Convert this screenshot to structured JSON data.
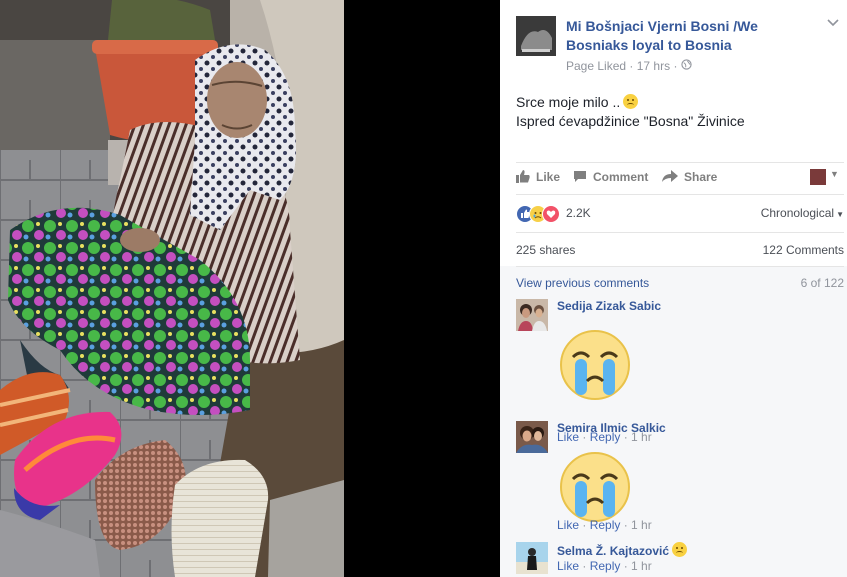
{
  "page": {
    "name_line1": "Mi Bošnjaci Vjerni Bosni /We",
    "name_line2": "Bosniaks loyal to Bosnia",
    "liked_status": "Page Liked",
    "time": "17 hrs",
    "separator": "·",
    "privacy_icon": "globe-icon"
  },
  "post": {
    "line1": "Srce moje milo ..",
    "line2": "Ispred ćevapdžinice \"Bosna\" Živinice"
  },
  "actions": {
    "like": "Like",
    "comment": "Comment",
    "share": "Share"
  },
  "reactions": {
    "count": "2.2K",
    "sort": "Chronological"
  },
  "stats": {
    "shares": "225 shares",
    "comments": "122 Comments"
  },
  "comments_section": {
    "view_previous": "View previous comments",
    "position": "6 of 122",
    "items": [
      {
        "name": "Sedija Zizak Sabic",
        "like": "Like",
        "reply": "Reply",
        "time": "1 hr",
        "sticker": "crying-sticker"
      },
      {
        "name": "Semira Ilmic Salkic",
        "like": "Like",
        "reply": "Reply",
        "time": "1 hr",
        "sticker": "crying-sticker"
      },
      {
        "name": "Selma Ž. Kajtazović",
        "like": "Like",
        "reply": "Reply",
        "time": "1 hr"
      }
    ]
  },
  "colors": {
    "link_blue": "#365899",
    "like_blue": "#4267b2",
    "meta_grey": "#90949c",
    "love_red": "#f25268",
    "sad_yellow": "#f7d048"
  }
}
